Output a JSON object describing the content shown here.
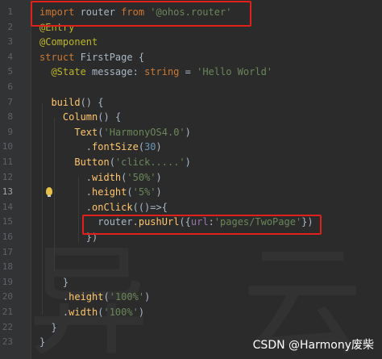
{
  "editor": {
    "line_numbers": [
      "1",
      "2",
      "3",
      "4",
      "5",
      "6",
      "7",
      "8",
      "9",
      "10",
      "11",
      "12",
      "13",
      "14",
      "15",
      "16",
      "17",
      "18",
      "19",
      "20",
      "21",
      "22",
      "23"
    ],
    "lines": [
      [
        {
          "t": "import ",
          "c": "kw"
        },
        {
          "t": "router ",
          "c": "cls"
        },
        {
          "t": "from ",
          "c": "kw"
        },
        {
          "t": "'@ohos.router'",
          "c": "str"
        }
      ],
      [
        {
          "t": "@Entry",
          "c": "ann"
        }
      ],
      [
        {
          "t": "@Component",
          "c": "ann"
        }
      ],
      [
        {
          "t": "struct ",
          "c": "kw"
        },
        {
          "t": "FirstPage ",
          "c": "cls"
        },
        {
          "t": "{",
          "c": "brace"
        }
      ],
      [
        {
          "t": "  ",
          "c": "cls"
        },
        {
          "t": "@State ",
          "c": "ann"
        },
        {
          "t": "message",
          "c": "cls"
        },
        {
          "t": ": ",
          "c": "cls"
        },
        {
          "t": "string ",
          "c": "type"
        },
        {
          "t": "= ",
          "c": "cls"
        },
        {
          "t": "'Hello World'",
          "c": "str"
        }
      ],
      [],
      [
        {
          "t": "  ",
          "c": "cls"
        },
        {
          "t": "build",
          "c": "fn"
        },
        {
          "t": "() {",
          "c": "cls"
        }
      ],
      [
        {
          "t": "    ",
          "c": "cls"
        },
        {
          "t": "Column",
          "c": "fn"
        },
        {
          "t": "() {",
          "c": "cls"
        }
      ],
      [
        {
          "t": "      ",
          "c": "cls"
        },
        {
          "t": "Text",
          "c": "fn"
        },
        {
          "t": "(",
          "c": "cls"
        },
        {
          "t": "'HarmonyOS4.0'",
          "c": "str"
        },
        {
          "t": ")",
          "c": "cls"
        }
      ],
      [
        {
          "t": "        .",
          "c": "cls"
        },
        {
          "t": "fontSize",
          "c": "fn"
        },
        {
          "t": "(",
          "c": "cls"
        },
        {
          "t": "30",
          "c": "num"
        },
        {
          "t": ")",
          "c": "cls"
        }
      ],
      [
        {
          "t": "      ",
          "c": "cls"
        },
        {
          "t": "Button",
          "c": "fn"
        },
        {
          "t": "(",
          "c": "cls"
        },
        {
          "t": "'click.....'",
          "c": "str"
        },
        {
          "t": ")",
          "c": "cls"
        }
      ],
      [
        {
          "t": "        .",
          "c": "cls"
        },
        {
          "t": "width",
          "c": "fn"
        },
        {
          "t": "(",
          "c": "cls"
        },
        {
          "t": "'50%'",
          "c": "str"
        },
        {
          "t": ")",
          "c": "cls"
        }
      ],
      [
        {
          "t": "        .",
          "c": "cls"
        },
        {
          "t": "height",
          "c": "fn"
        },
        {
          "t": "(",
          "c": "cls"
        },
        {
          "t": "'5%'",
          "c": "str"
        },
        {
          "t": ")",
          "c": "cls"
        }
      ],
      [
        {
          "t": "        .",
          "c": "cls"
        },
        {
          "t": "onClick",
          "c": "fn"
        },
        {
          "t": "(()=>{",
          "c": "cls"
        }
      ],
      [
        {
          "t": "          ",
          "c": "cls"
        },
        {
          "t": "router",
          "c": "cls"
        },
        {
          "t": ".",
          "c": "cls"
        },
        {
          "t": "pushUrl",
          "c": "fn"
        },
        {
          "t": "({",
          "c": "cls"
        },
        {
          "t": "url",
          "c": "prop"
        },
        {
          "t": ":",
          "c": "cls"
        },
        {
          "t": "'pages/TwoPage'",
          "c": "str"
        },
        {
          "t": "})",
          "c": "cls"
        }
      ],
      [
        {
          "t": "        })",
          "c": "cls"
        }
      ],
      [],
      [],
      [
        {
          "t": "    }",
          "c": "cls"
        }
      ],
      [
        {
          "t": "    .",
          "c": "cls"
        },
        {
          "t": "height",
          "c": "fn"
        },
        {
          "t": "(",
          "c": "cls"
        },
        {
          "t": "'100%'",
          "c": "str"
        },
        {
          "t": ")",
          "c": "cls"
        }
      ],
      [
        {
          "t": "    .",
          "c": "cls"
        },
        {
          "t": "width",
          "c": "fn"
        },
        {
          "t": "(",
          "c": "cls"
        },
        {
          "t": "'100%'",
          "c": "str"
        },
        {
          "t": ")",
          "c": "cls"
        }
      ],
      [
        {
          "t": "  }",
          "c": "cls"
        }
      ],
      [
        {
          "t": "}",
          "c": "cls"
        }
      ]
    ],
    "active_line": "13",
    "intention_icon": "lightbulb-icon"
  },
  "watermark": "CSDN @Harmony废柴",
  "colors": {
    "background": "#2b2b2b",
    "keyword": "#cc7832",
    "string": "#6a8759",
    "annotation": "#bbb529",
    "function": "#ffc66d",
    "number": "#6897bb",
    "highlight_box": "#e0211b"
  }
}
